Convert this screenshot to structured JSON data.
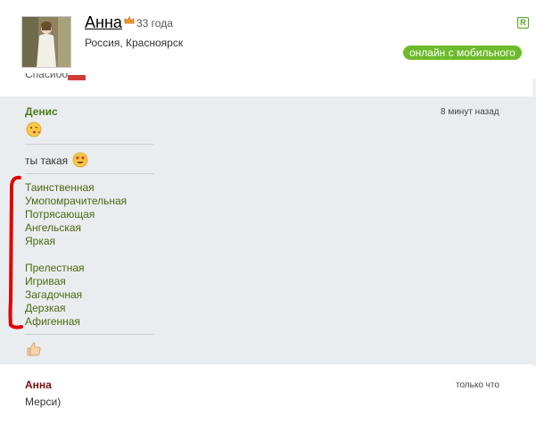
{
  "profile": {
    "name": "Анна",
    "age": "33 года",
    "location": "Россия, Красноярск",
    "status_badge": "онлайн с мобильного",
    "reg_icon_label": "R"
  },
  "partial_previous": "Спасибо",
  "colors": {
    "online_badge": "#6dbb2a",
    "author_green": "#4a7a1c",
    "author_red": "#7a1010",
    "word_green": "#4a6a10",
    "highlight_red": "#e00000"
  },
  "messages": [
    {
      "author": "Денис",
      "time": "8 минут назад",
      "lines": [
        {
          "type": "emoji",
          "icon": "kiss-emoji-icon"
        },
        {
          "type": "text",
          "text": "ты такая",
          "icon": "heart-eyes-emoji-icon"
        }
      ],
      "words_group1": [
        "Таинственная",
        "Умопомрачительная",
        "Потрясающая",
        "Ангельская",
        "Яркая"
      ],
      "words_group2": [
        "Прелестная",
        "Игривая",
        "Загадочная",
        "Дерзкая",
        "Афигенная"
      ],
      "footer_icon": "thumbs-up-icon"
    },
    {
      "author": "Анна",
      "time": "только что",
      "text": "Мерси)"
    }
  ]
}
